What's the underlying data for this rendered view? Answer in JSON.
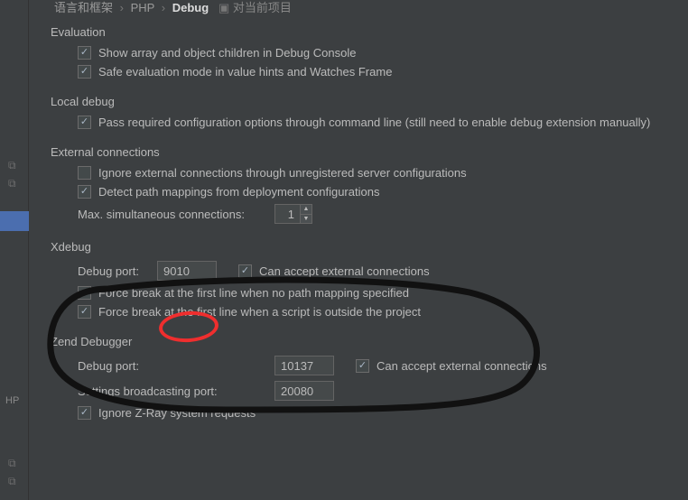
{
  "breadcrumb": {
    "a": "语言和框架",
    "b": "PHP",
    "c": "Debug",
    "badge": "对当前项目"
  },
  "sidebar": {
    "hp_label": "HP"
  },
  "evaluation": {
    "title": "Evaluation",
    "show_array": "Show array and object children in Debug Console",
    "safe_eval": "Safe evaluation mode in value hints and Watches Frame"
  },
  "local_debug": {
    "title": "Local debug",
    "pass_config": "Pass required configuration options through command line (still need to enable debug extension manually)"
  },
  "external": {
    "title": "External connections",
    "ignore": "Ignore external connections through unregistered server configurations",
    "detect": "Detect path mappings from deployment configurations",
    "max_label": "Max. simultaneous connections:",
    "max_value": "1"
  },
  "xdebug": {
    "title": "Xdebug",
    "port_label": "Debug port:",
    "port_value": "9010",
    "accept": "Can accept external connections",
    "force1": "Force break at the first line when no path mapping specified",
    "force2": "Force break at the first line when a script is outside the project"
  },
  "zend": {
    "title": "Zend Debugger",
    "port_label": "Debug port:",
    "port_value": "10137",
    "accept": "Can accept external connections",
    "broadcast_label": "Settings broadcasting port:",
    "broadcast_value": "20080",
    "ignore_zray": "Ignore Z-Ray system requests"
  }
}
